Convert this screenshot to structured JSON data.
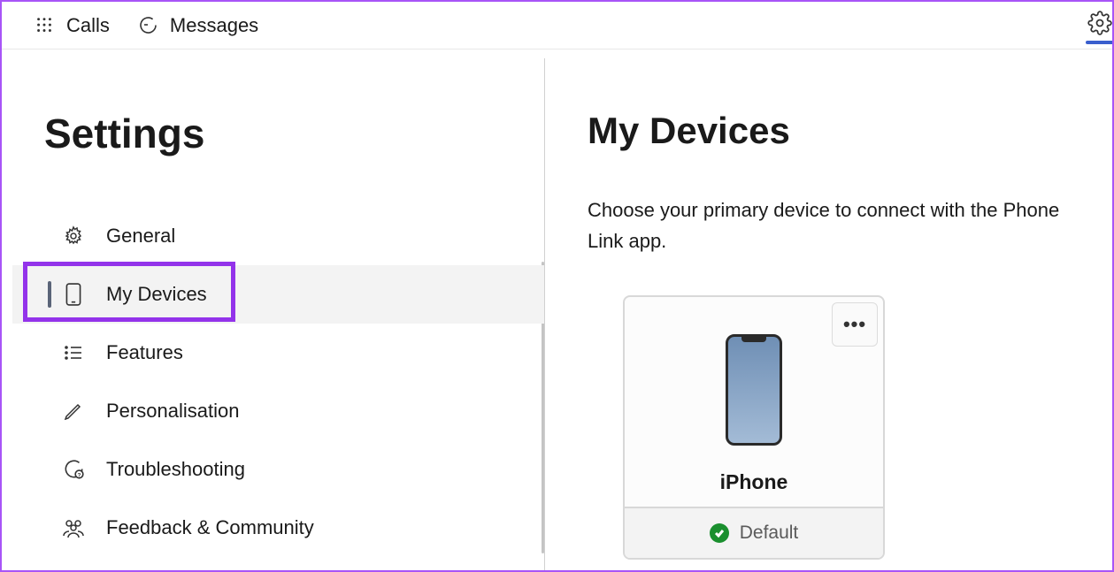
{
  "topnav": {
    "calls": "Calls",
    "messages": "Messages"
  },
  "sidebar": {
    "title": "Settings",
    "items": [
      {
        "label": "General",
        "icon": "gear"
      },
      {
        "label": "My Devices",
        "icon": "phone",
        "active": true
      },
      {
        "label": "Features",
        "icon": "list"
      },
      {
        "label": "Personalisation",
        "icon": "pen"
      },
      {
        "label": "Troubleshooting",
        "icon": "help"
      },
      {
        "label": "Feedback & Community",
        "icon": "people"
      }
    ]
  },
  "main": {
    "title": "My Devices",
    "description": "Choose your primary device to connect with the Phone Link app.",
    "device": {
      "name": "iPhone",
      "status": "Default"
    }
  }
}
